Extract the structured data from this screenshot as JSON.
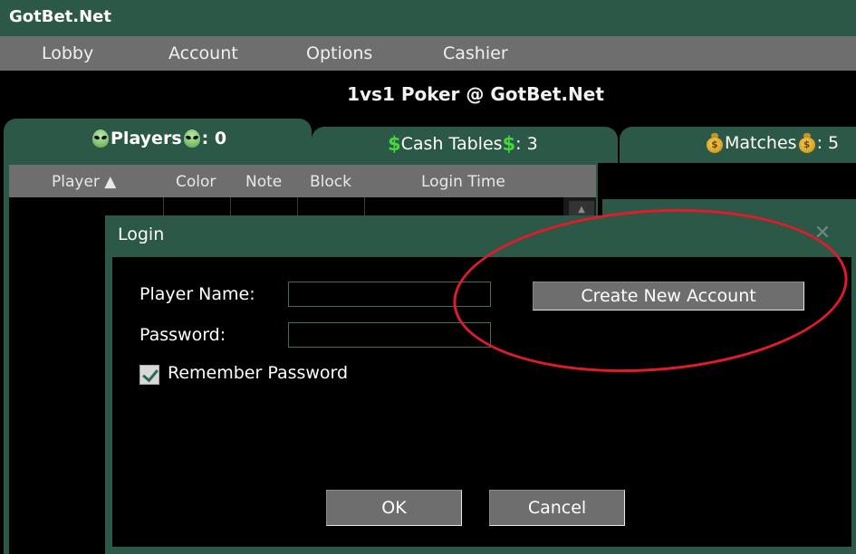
{
  "window": {
    "title": "GotBet.Net"
  },
  "menu": {
    "items": [
      {
        "label": "Lobby"
      },
      {
        "label": "Account"
      },
      {
        "label": "Options"
      },
      {
        "label": "Cashier"
      }
    ]
  },
  "page": {
    "heading": "1vs1 Poker @ GotBet.Net"
  },
  "tabs": {
    "players": {
      "label": "Players",
      "count": ": 0"
    },
    "cash_tables": {
      "label": "Cash Tables",
      "count": ": 3"
    },
    "matches": {
      "label": "Matches",
      "count": ": 5"
    }
  },
  "players_table": {
    "columns": [
      "Player ▲",
      "Color",
      "Note",
      "Block",
      "Login Time"
    ],
    "rows": []
  },
  "login_dialog": {
    "title": "Login",
    "close_symbol": "✕",
    "player_name_label": "Player Name:",
    "player_name_value": "",
    "password_label": "Password:",
    "password_value": "",
    "remember_label": "Remember Password",
    "remember_checked": true,
    "create_account_label": "Create New Account",
    "ok_label": "OK",
    "cancel_label": "Cancel"
  },
  "colors": {
    "primary_green": "#2c5847",
    "menu_gray": "#6e6e6e",
    "annotation_red": "#e01b2a",
    "dollar_green": "#46d63c"
  },
  "icons": {
    "players_tab": "alien-icon",
    "cash_tab": "dollar-icon",
    "matches_tab": "moneybag-icon"
  }
}
